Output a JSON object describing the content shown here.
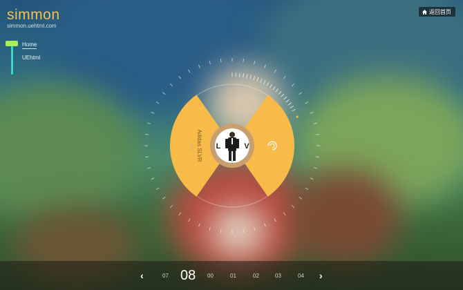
{
  "logo": {
    "title": "simmon",
    "subtitle": "simmon.uehtml.com"
  },
  "header": {
    "back_label": "返回首页",
    "back_icon": "home-icon"
  },
  "sidebar": {
    "items": [
      {
        "label": "Home",
        "active": true
      },
      {
        "label": "UEhtml",
        "active": false
      }
    ]
  },
  "dial": {
    "product_name": "Adidas SLVR",
    "product_sub": "1900",
    "left_letter": "L",
    "right_letter": "V",
    "brand_icon": "slvr-brand-icon",
    "colors": {
      "accent": "#f8bb4a",
      "center_ring": "#c8a070"
    }
  },
  "pagination": {
    "current": "08",
    "items": [
      "07",
      "00",
      "01",
      "02",
      "03",
      "04"
    ],
    "prev_icon": "chevron-left-icon",
    "next_icon": "chevron-right-icon"
  }
}
